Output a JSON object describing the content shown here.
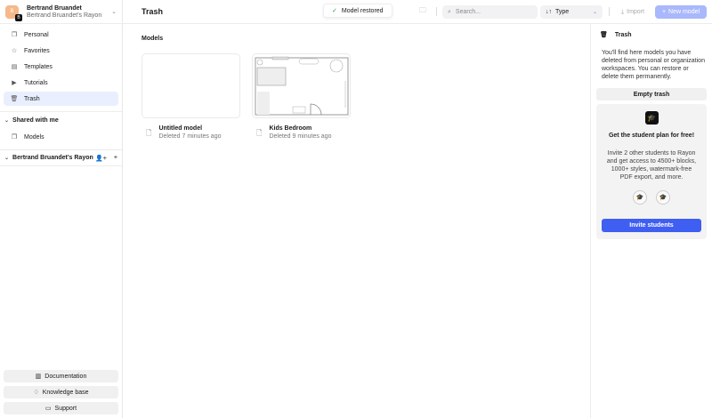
{
  "account": {
    "initial": "B",
    "badge": "B",
    "name": "Bertrand Bruandet",
    "workspace": "Bertrand Bruandet's Rayon"
  },
  "nav": [
    {
      "label": "Personal"
    },
    {
      "label": "Favorites"
    },
    {
      "label": "Templates"
    },
    {
      "label": "Tutorials"
    },
    {
      "label": "Trash"
    }
  ],
  "shared": {
    "label": "Shared with me",
    "items": [
      {
        "label": "Models"
      }
    ]
  },
  "workspace": {
    "label": "Bertrand Bruandet's Rayon"
  },
  "bottom": {
    "documentation": "Documentation",
    "knowledge": "Knowledge base",
    "support": "Support"
  },
  "header": {
    "title": "Trash",
    "toast": "Model restored",
    "search_placeholder": "Search...",
    "type": "Type",
    "import": "Import",
    "new_model": "New model"
  },
  "main": {
    "section": "Models",
    "models": [
      {
        "title": "Untitled model",
        "subtitle": "Deleted 7 minutes ago"
      },
      {
        "title": "Kids Bedroom",
        "subtitle": "Deleted 9 minutes ago"
      }
    ]
  },
  "panel": {
    "title": "Trash",
    "description": "You'll find here models you have deleted from personal or organization workspaces. You can restore or delete them permanently.",
    "empty": "Empty trash",
    "promo_title": "Get the student plan for free!",
    "promo_body": "Invite 2 other students to Rayon and get access to 4500+ blocks, 1000+ styles, watermark-free PDF export, and more.",
    "invite": "Invite students"
  }
}
